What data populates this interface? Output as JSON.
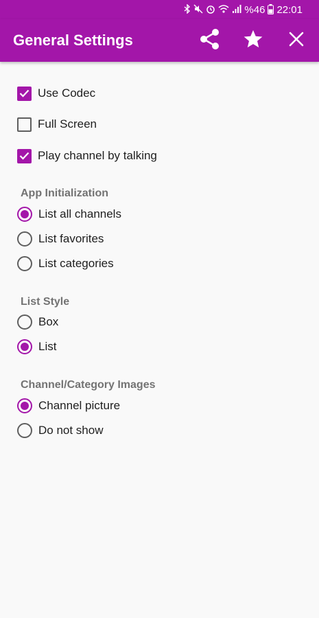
{
  "status": {
    "battery_pct": "%46",
    "time": "22:01",
    "icons": [
      "bluetooth-icon",
      "mute-icon",
      "alarm-icon",
      "wifi-icon",
      "signal-icon",
      "battery-icon"
    ]
  },
  "header": {
    "title": "General Settings",
    "actions": [
      "share-icon",
      "star-icon",
      "close-icon"
    ]
  },
  "options": {
    "use_codec": {
      "label": "Use Codec",
      "checked": true
    },
    "full_screen": {
      "label": "Full Screen",
      "checked": false
    },
    "play_by_talking": {
      "label": "Play channel by talking",
      "checked": true
    }
  },
  "app_init": {
    "title": "App Initialization",
    "items": [
      {
        "label": "List all channels",
        "selected": true
      },
      {
        "label": "List favorites",
        "selected": false
      },
      {
        "label": "List categories",
        "selected": false
      }
    ]
  },
  "list_style": {
    "title": "List Style",
    "items": [
      {
        "label": "Box",
        "selected": false
      },
      {
        "label": "List",
        "selected": true
      }
    ]
  },
  "images": {
    "title": "Channel/Category Images",
    "items": [
      {
        "label": "Channel picture",
        "selected": true
      },
      {
        "label": "Do not show",
        "selected": false
      }
    ]
  },
  "colors": {
    "accent": "#a316a9",
    "background": "#f9f9f9"
  }
}
